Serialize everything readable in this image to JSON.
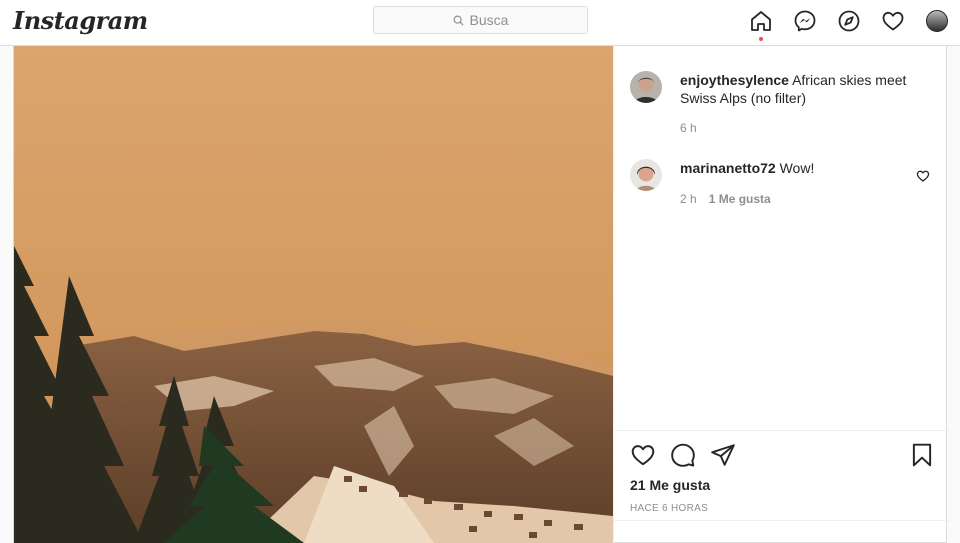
{
  "header": {
    "logo": "Instagram",
    "search_placeholder": "Busca",
    "nav": [
      "home-icon",
      "messenger-icon",
      "explore-icon",
      "activity-heart-icon",
      "profile-avatar"
    ],
    "notification_color": "#ed4956"
  },
  "post": {
    "caption": {
      "username": "enjoythesylence",
      "text": "African skies meet Swiss Alps (no filter)",
      "time": "6 h"
    },
    "comments": [
      {
        "username": "marinanetto72",
        "text": "Wow!",
        "time": "2 h",
        "likes": "1 Me gusta"
      }
    ],
    "likes": "21 Me gusta",
    "timestamp": "HACE 6 HORAS"
  },
  "colors": {
    "sky": "#d9a36b",
    "text": "#262626",
    "muted": "#8e8e8e",
    "border": "#dbdbdb"
  }
}
